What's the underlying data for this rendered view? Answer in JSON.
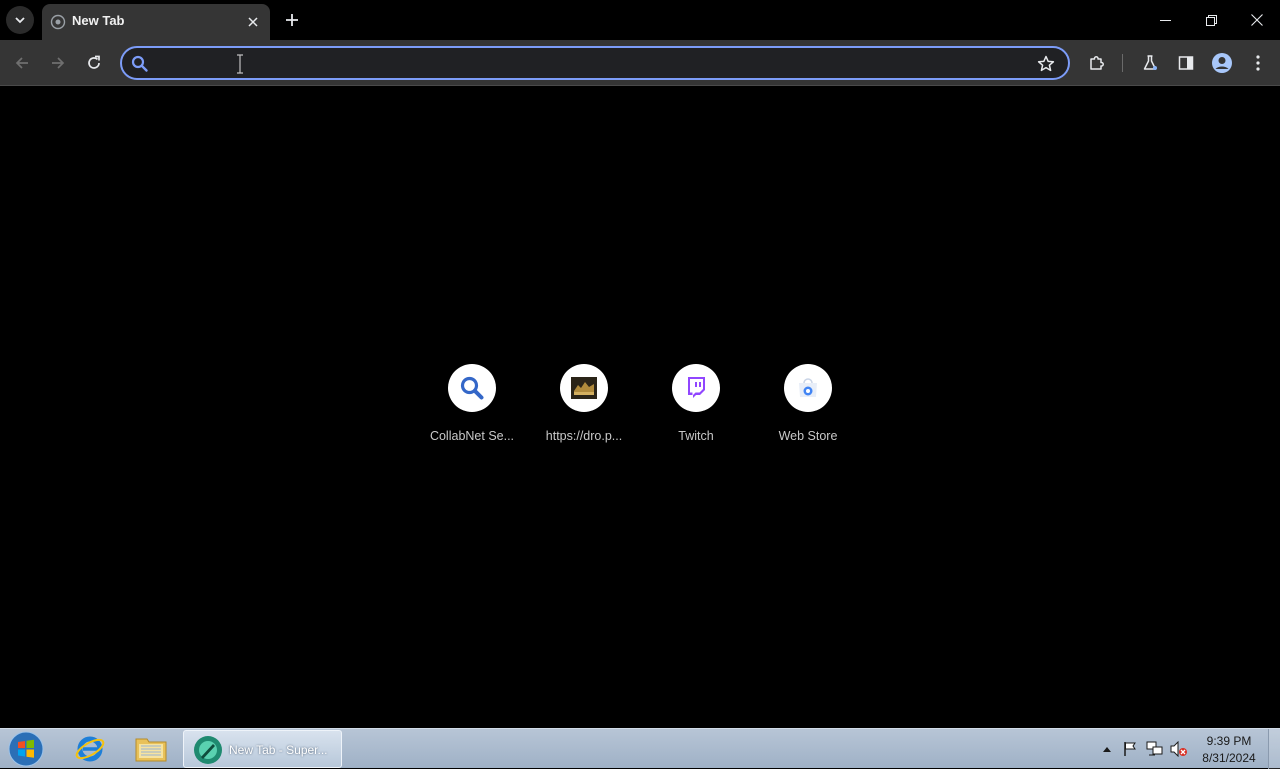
{
  "window": {
    "tab_title": "New Tab"
  },
  "omnibox": {
    "value": "",
    "placeholder": ""
  },
  "shortcuts": [
    {
      "label": "CollabNet Se...",
      "icon": "search-icon"
    },
    {
      "label": "https://dro.p...",
      "icon": "site-favicon"
    },
    {
      "label": "Twitch",
      "icon": "twitch-icon"
    },
    {
      "label": "Web Store",
      "icon": "web-store-icon"
    }
  ],
  "taskbar": {
    "window_label": "New Tab - Super...",
    "time": "9:39 PM",
    "date": "8/31/2024"
  },
  "colors": {
    "omnibox_focus": "#7c9cf8",
    "background": "#000000",
    "toolbar": "#353535",
    "twitch": "#9146ff"
  }
}
